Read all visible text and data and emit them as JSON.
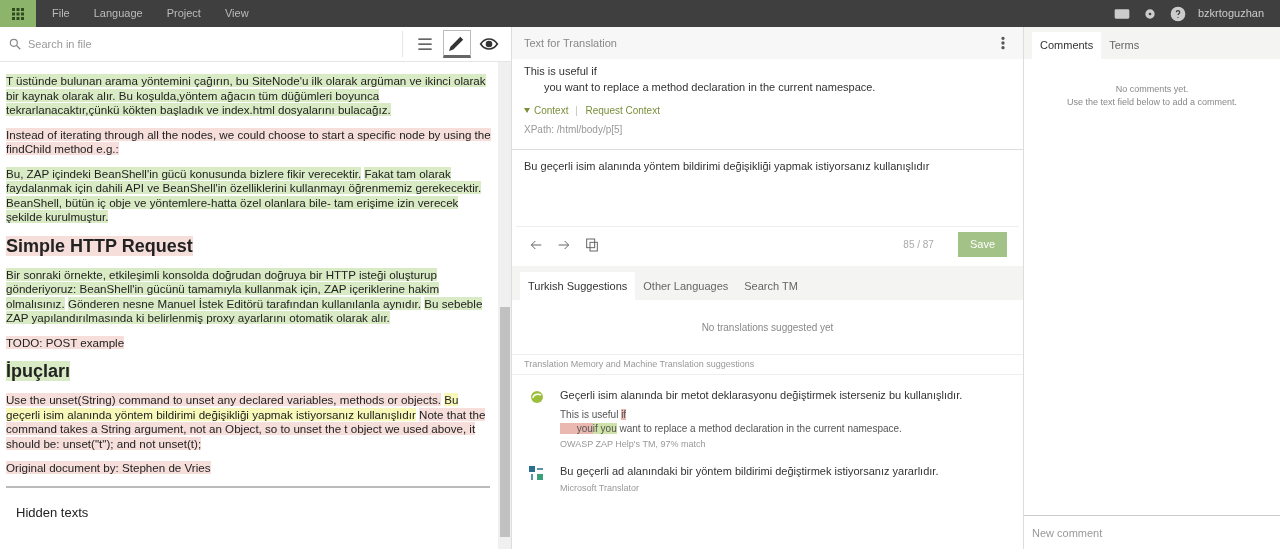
{
  "menu": {
    "items": [
      "File",
      "Language",
      "Project",
      "View"
    ],
    "username": "bzkrtoguzhan"
  },
  "editor": {
    "search_placeholder": "Search in file",
    "views": [
      {
        "kind": "list",
        "selected": false
      },
      {
        "kind": "edit",
        "selected": true
      },
      {
        "kind": "preview",
        "selected": false
      }
    ],
    "blocks": [
      {
        "kind": "p",
        "segments": [
          {
            "text": "T üstünde bulunan arama yöntemini çağırın, bu SiteNode'u ilk olarak argüman ve ikinci olarak bir kaynak olarak alır. Bu koşulda,yöntem ağacın tüm düğümleri boyunca tekrarlanacaktır,çünkü kökten başladık ve index.html dosyalarını bulacağız.",
            "translated": true,
            "selected": false
          }
        ]
      },
      {
        "kind": "p",
        "segments": [
          {
            "text": "Instead of iterating through all the nodes, we could choose to start a specific node by using the findChild method e.g.:",
            "translated": false,
            "selected": false
          }
        ]
      },
      {
        "kind": "p",
        "segments": [
          {
            "text": "Bu, ZAP içindeki BeanShell'in gücü konusunda bizlere fikir verecektir.",
            "translated": true,
            "selected": false
          },
          {
            "text": "Fakat tam olarak faydalanmak için dahili API ve BeanShell'in özelliklerini kullanmayı öğrenmemiz gerekecektir. BeanShell, bütün iç obje ve yöntemlere-hatta özel olanlara bile- tam erişime izin verecek şekilde kurulmuştur.",
            "translated": true,
            "selected": false
          }
        ]
      },
      {
        "kind": "h",
        "segments": [
          {
            "text": "Simple HTTP Request",
            "translated": false,
            "selected": false
          }
        ]
      },
      {
        "kind": "p",
        "segments": [
          {
            "text": "Bir sonraki örnekte, etkileşimli konsolda doğrudan doğruya bir HTTP isteği oluşturup gönderiyoruz: BeanShell'in gücünü tamamıyla kullanmak için, ZAP içeriklerine hakim olmalısınız.",
            "translated": true,
            "selected": false
          },
          {
            "text": "Gönderen nesne Manuel İstek Editörü tarafından kullanılanla aynıdır.",
            "translated": true,
            "selected": false
          },
          {
            "text": "Bu sebeble ZAP yapılandırılmasında ki belirlenmiş proxy ayarlarını otomatik olarak alır.",
            "translated": true,
            "selected": false
          }
        ]
      },
      {
        "kind": "p",
        "segments": [
          {
            "text": "TODO: POST example",
            "translated": false,
            "selected": false
          }
        ]
      },
      {
        "kind": "h",
        "segments": [
          {
            "text": "İpuçları",
            "translated": true,
            "selected": false
          }
        ]
      },
      {
        "kind": "p",
        "segments": [
          {
            "text": "Use the unset(String) command to unset any declared variables, methods or objects.",
            "translated": false,
            "selected": false
          },
          {
            "text": "Bu geçerli isim alanında yöntem bildirimi değişikliği yapmak istiyorsanız kullanışlıdır",
            "translated": false,
            "selected": true
          },
          {
            "text": "Note that the command takes a String argument, not an Object, so to unset the t object we used above, it should be: unset(\"t\"); and not unset(t);",
            "translated": false,
            "selected": false
          }
        ]
      },
      {
        "kind": "p",
        "segments": [
          {
            "text": "Original document by: Stephen de Vries",
            "translated": false,
            "selected": false
          }
        ]
      }
    ],
    "hidden_title": "Hidden texts"
  },
  "translation": {
    "title": "Text for Translation",
    "source_lines": [
      "This is useful if",
      "you want to replace a method declaration in the current namespace."
    ],
    "context_label": "Context",
    "context_link": "Request Context",
    "xpath": "XPath: /html/body/p[5]",
    "value": "Bu geçerli isim alanında yöntem bildirimi değişikliği yapmak istiyorsanız kullanışlıdır",
    "counter": "85 / 87",
    "save": "Save"
  },
  "suggestions": {
    "tabs": [
      {
        "label": "Turkish Suggestions",
        "selected": true
      },
      {
        "label": "Other Languages",
        "selected": false
      },
      {
        "label": "Search TM",
        "selected": false
      }
    ],
    "empty": "No translations suggested yet",
    "section": "Translation Memory and Machine Translation suggestions",
    "items": [
      {
        "kind": "tm",
        "text": "Geçerli isim alanında bir metot deklarasyonu değiştirmek isterseniz bu kullanışlıdır.",
        "source_lines": [
          [
            {
              "text": "This is useful ",
              "removed": false,
              "added": false
            },
            {
              "text": "if",
              "removed": true,
              "added": false
            }
          ],
          [
            {
              "text": "      you",
              "removed": true,
              "added": false
            },
            {
              "text": "if you",
              "removed": false,
              "added": true
            },
            {
              "text": " want to replace a method declaration in the current namespace.",
              "removed": false,
              "added": false
            }
          ]
        ],
        "origin": "OWASP ZAP Help's TM, 97% match"
      },
      {
        "kind": "mt",
        "text": "Bu geçerli ad alanındaki bir yöntem bildirimi değiştirmek istiyorsanız yararlıdır.",
        "origin": "Microsoft Translator"
      }
    ]
  },
  "comments": {
    "tabs": [
      {
        "label": "Comments",
        "selected": true
      },
      {
        "label": "Terms",
        "selected": false
      }
    ],
    "empty_lines": [
      "No comments yet.",
      "Use the text field below to add a comment."
    ],
    "placeholder": "New comment"
  }
}
